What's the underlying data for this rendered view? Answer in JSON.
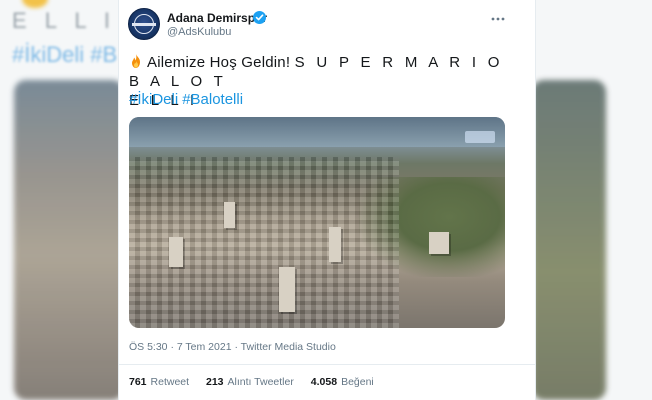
{
  "background": {
    "top_text": "E L L I",
    "top_tags": "#İkiDeli #B"
  },
  "tweet": {
    "author_name": "Adana Demirspor",
    "author_handle": "@AdsKulubu",
    "verified": true,
    "more_icon": "more-dots-icon",
    "text_prefix": "Ailemize Hoş Geldin! ",
    "text_spaced_line1": "S U P E R  M A R I O  B A L O T",
    "text_spaced_line2": "E L L I",
    "hashtags": [
      "#İkiDeli",
      "#Balotelli"
    ],
    "timestamp": "ÖS 5:30 · 7 Tem 2021 · Twitter Media Studio",
    "stats": {
      "retweets_count": "761",
      "retweets_label": "Retweet",
      "quotes_count": "213",
      "quotes_label": "Alıntı Tweetler",
      "likes_count": "4.058",
      "likes_label": "Beğeni"
    }
  },
  "colors": {
    "link": "#1b95e0",
    "verified": "#1da1f2",
    "text": "#14171a",
    "muted": "#657786"
  }
}
